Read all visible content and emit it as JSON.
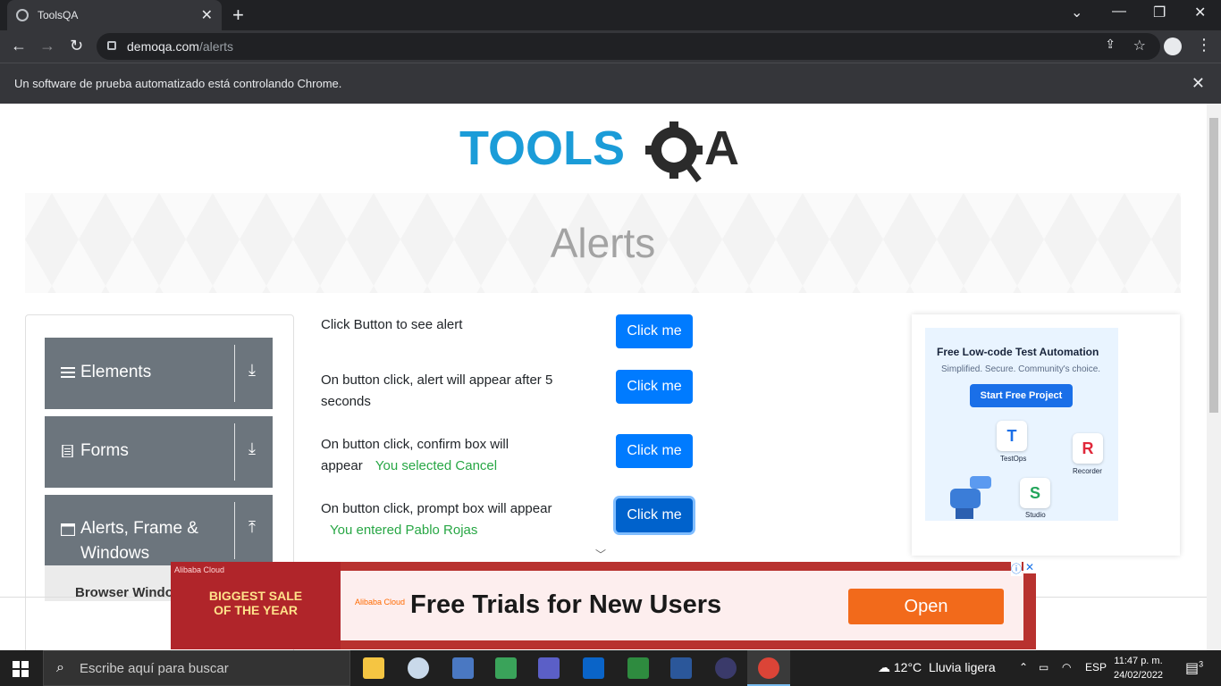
{
  "browser": {
    "tab_title": "ToolsQA",
    "new_tab_symbol": "+",
    "url_host": "demoqa.com",
    "url_path": "/alerts",
    "infobar_text": "Un software de prueba automatizado está controlando Chrome."
  },
  "page": {
    "banner_title": "Alerts",
    "sidebar": {
      "groups": [
        {
          "label": "Elements",
          "icon": "menu-icon",
          "arrow": "download-icon"
        },
        {
          "label": "Forms",
          "icon": "form-icon",
          "arrow": "download-icon"
        },
        {
          "label": "Alerts, Frame & Windows",
          "icon": "window-icon",
          "arrow": "upload-icon"
        }
      ],
      "active_item": "Browser Windows"
    },
    "alerts": [
      {
        "text": "Click Button to see alert",
        "button": "Click me",
        "result": ""
      },
      {
        "text": "On button click, alert will appear after 5 seconds",
        "button": "Click me",
        "result": ""
      },
      {
        "text": "On button click, confirm box will appear",
        "button": "Click me",
        "result": "You selected Cancel"
      },
      {
        "text": "On button click, prompt box will appear",
        "button": "Click me",
        "result": "You entered Pablo Rojas"
      }
    ],
    "side_ad": {
      "title": "Free Low-code Test Automation",
      "subtitle": "Simplified. Secure. Community's choice.",
      "cta": "Start Free Project",
      "apps": [
        "TestOps",
        "Recorder",
        "Studio"
      ]
    },
    "bottom_ad": {
      "brand": "Alibaba Cloud",
      "promo": "BIGGEST SALE OF THE YEAR",
      "headline": "Free Trials for New Users",
      "cta": "Open"
    }
  },
  "taskbar": {
    "search_placeholder": "Escribe aquí para buscar",
    "weather_temp": "12°C",
    "weather_text": "Lluvia ligera",
    "lang": "ESP",
    "time": "11:47 p. m.",
    "date": "24/02/2022",
    "notifications": "3"
  },
  "colors": {
    "primary_button": "#007bff",
    "success_text": "#28a745",
    "sidebar_group": "#6c757d",
    "ad_orange": "#f26a1b"
  }
}
